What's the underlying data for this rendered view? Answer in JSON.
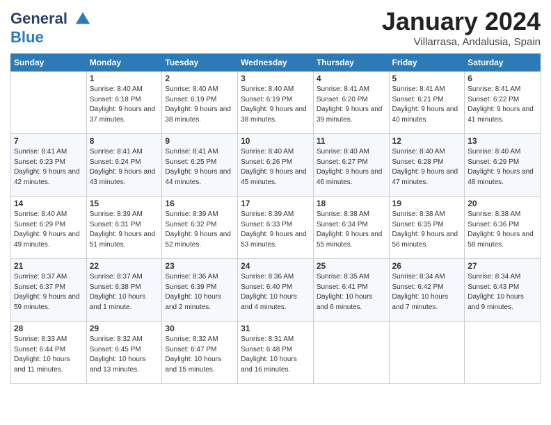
{
  "logo": {
    "line1": "General",
    "line2": "Blue"
  },
  "title": "January 2024",
  "location": "Villarrasa, Andalusia, Spain",
  "weekdays": [
    "Sunday",
    "Monday",
    "Tuesday",
    "Wednesday",
    "Thursday",
    "Friday",
    "Saturday"
  ],
  "weeks": [
    [
      {
        "day": "",
        "sunrise": "",
        "sunset": "",
        "daylight": ""
      },
      {
        "day": "1",
        "sunrise": "Sunrise: 8:40 AM",
        "sunset": "Sunset: 6:18 PM",
        "daylight": "Daylight: 9 hours and 37 minutes."
      },
      {
        "day": "2",
        "sunrise": "Sunrise: 8:40 AM",
        "sunset": "Sunset: 6:19 PM",
        "daylight": "Daylight: 9 hours and 38 minutes."
      },
      {
        "day": "3",
        "sunrise": "Sunrise: 8:40 AM",
        "sunset": "Sunset: 6:19 PM",
        "daylight": "Daylight: 9 hours and 38 minutes."
      },
      {
        "day": "4",
        "sunrise": "Sunrise: 8:41 AM",
        "sunset": "Sunset: 6:20 PM",
        "daylight": "Daylight: 9 hours and 39 minutes."
      },
      {
        "day": "5",
        "sunrise": "Sunrise: 8:41 AM",
        "sunset": "Sunset: 6:21 PM",
        "daylight": "Daylight: 9 hours and 40 minutes."
      },
      {
        "day": "6",
        "sunrise": "Sunrise: 8:41 AM",
        "sunset": "Sunset: 6:22 PM",
        "daylight": "Daylight: 9 hours and 41 minutes."
      }
    ],
    [
      {
        "day": "7",
        "sunrise": "Sunrise: 8:41 AM",
        "sunset": "Sunset: 6:23 PM",
        "daylight": "Daylight: 9 hours and 42 minutes."
      },
      {
        "day": "8",
        "sunrise": "Sunrise: 8:41 AM",
        "sunset": "Sunset: 6:24 PM",
        "daylight": "Daylight: 9 hours and 43 minutes."
      },
      {
        "day": "9",
        "sunrise": "Sunrise: 8:41 AM",
        "sunset": "Sunset: 6:25 PM",
        "daylight": "Daylight: 9 hours and 44 minutes."
      },
      {
        "day": "10",
        "sunrise": "Sunrise: 8:40 AM",
        "sunset": "Sunset: 6:26 PM",
        "daylight": "Daylight: 9 hours and 45 minutes."
      },
      {
        "day": "11",
        "sunrise": "Sunrise: 8:40 AM",
        "sunset": "Sunset: 6:27 PM",
        "daylight": "Daylight: 9 hours and 46 minutes."
      },
      {
        "day": "12",
        "sunrise": "Sunrise: 8:40 AM",
        "sunset": "Sunset: 6:28 PM",
        "daylight": "Daylight: 9 hours and 47 minutes."
      },
      {
        "day": "13",
        "sunrise": "Sunrise: 8:40 AM",
        "sunset": "Sunset: 6:29 PM",
        "daylight": "Daylight: 9 hours and 48 minutes."
      }
    ],
    [
      {
        "day": "14",
        "sunrise": "Sunrise: 8:40 AM",
        "sunset": "Sunset: 6:29 PM",
        "daylight": "Daylight: 9 hours and 49 minutes."
      },
      {
        "day": "15",
        "sunrise": "Sunrise: 8:39 AM",
        "sunset": "Sunset: 6:31 PM",
        "daylight": "Daylight: 9 hours and 51 minutes."
      },
      {
        "day": "16",
        "sunrise": "Sunrise: 8:39 AM",
        "sunset": "Sunset: 6:32 PM",
        "daylight": "Daylight: 9 hours and 52 minutes."
      },
      {
        "day": "17",
        "sunrise": "Sunrise: 8:39 AM",
        "sunset": "Sunset: 6:33 PM",
        "daylight": "Daylight: 9 hours and 53 minutes."
      },
      {
        "day": "18",
        "sunrise": "Sunrise: 8:38 AM",
        "sunset": "Sunset: 6:34 PM",
        "daylight": "Daylight: 9 hours and 55 minutes."
      },
      {
        "day": "19",
        "sunrise": "Sunrise: 8:38 AM",
        "sunset": "Sunset: 6:35 PM",
        "daylight": "Daylight: 9 hours and 56 minutes."
      },
      {
        "day": "20",
        "sunrise": "Sunrise: 8:38 AM",
        "sunset": "Sunset: 6:36 PM",
        "daylight": "Daylight: 9 hours and 58 minutes."
      }
    ],
    [
      {
        "day": "21",
        "sunrise": "Sunrise: 8:37 AM",
        "sunset": "Sunset: 6:37 PM",
        "daylight": "Daylight: 9 hours and 59 minutes."
      },
      {
        "day": "22",
        "sunrise": "Sunrise: 8:37 AM",
        "sunset": "Sunset: 6:38 PM",
        "daylight": "Daylight: 10 hours and 1 minute."
      },
      {
        "day": "23",
        "sunrise": "Sunrise: 8:36 AM",
        "sunset": "Sunset: 6:39 PM",
        "daylight": "Daylight: 10 hours and 2 minutes."
      },
      {
        "day": "24",
        "sunrise": "Sunrise: 8:36 AM",
        "sunset": "Sunset: 6:40 PM",
        "daylight": "Daylight: 10 hours and 4 minutes."
      },
      {
        "day": "25",
        "sunrise": "Sunrise: 8:35 AM",
        "sunset": "Sunset: 6:41 PM",
        "daylight": "Daylight: 10 hours and 6 minutes."
      },
      {
        "day": "26",
        "sunrise": "Sunrise: 8:34 AM",
        "sunset": "Sunset: 6:42 PM",
        "daylight": "Daylight: 10 hours and 7 minutes."
      },
      {
        "day": "27",
        "sunrise": "Sunrise: 8:34 AM",
        "sunset": "Sunset: 6:43 PM",
        "daylight": "Daylight: 10 hours and 9 minutes."
      }
    ],
    [
      {
        "day": "28",
        "sunrise": "Sunrise: 8:33 AM",
        "sunset": "Sunset: 6:44 PM",
        "daylight": "Daylight: 10 hours and 11 minutes."
      },
      {
        "day": "29",
        "sunrise": "Sunrise: 8:32 AM",
        "sunset": "Sunset: 6:45 PM",
        "daylight": "Daylight: 10 hours and 13 minutes."
      },
      {
        "day": "30",
        "sunrise": "Sunrise: 8:32 AM",
        "sunset": "Sunset: 6:47 PM",
        "daylight": "Daylight: 10 hours and 15 minutes."
      },
      {
        "day": "31",
        "sunrise": "Sunrise: 8:31 AM",
        "sunset": "Sunset: 6:48 PM",
        "daylight": "Daylight: 10 hours and 16 minutes."
      },
      {
        "day": "",
        "sunrise": "",
        "sunset": "",
        "daylight": ""
      },
      {
        "day": "",
        "sunrise": "",
        "sunset": "",
        "daylight": ""
      },
      {
        "day": "",
        "sunrise": "",
        "sunset": "",
        "daylight": ""
      }
    ]
  ]
}
